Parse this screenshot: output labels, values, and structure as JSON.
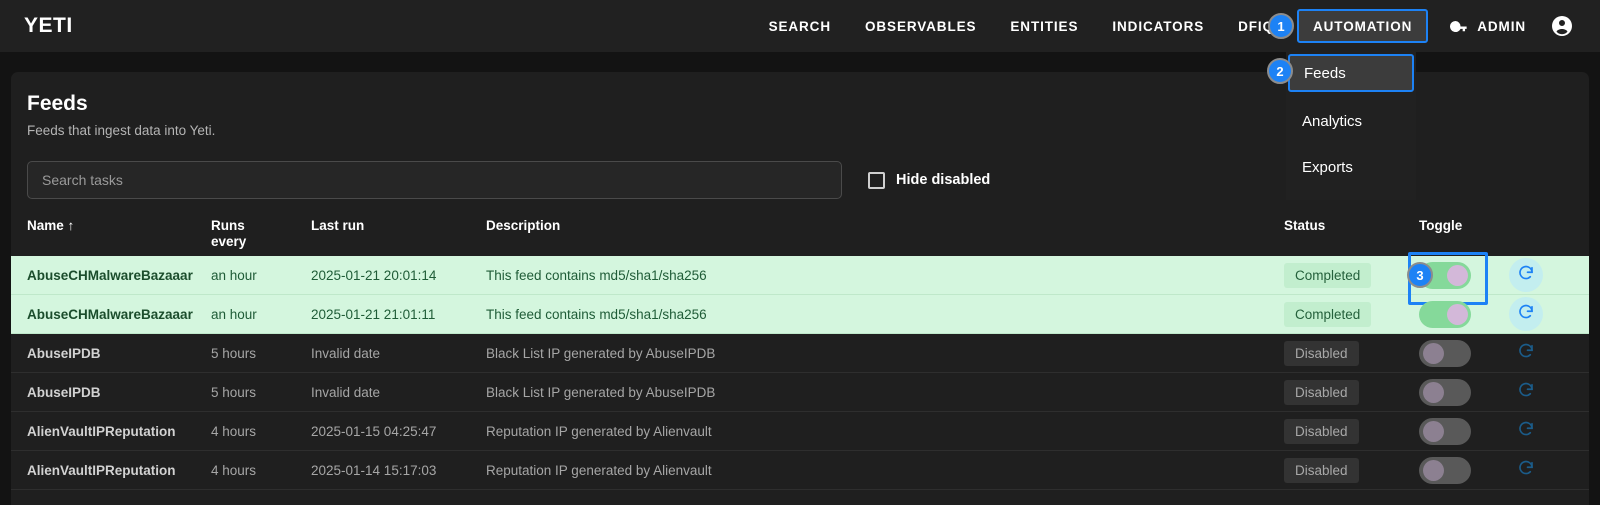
{
  "navbar": {
    "brand": "YETI",
    "items": [
      {
        "label": "SEARCH",
        "name": "nav-search"
      },
      {
        "label": "OBSERVABLES",
        "name": "nav-observables"
      },
      {
        "label": "ENTITIES",
        "name": "nav-entities"
      },
      {
        "label": "INDICATORS",
        "name": "nav-indicators"
      },
      {
        "label": "DFIQ",
        "name": "nav-dfiq"
      }
    ],
    "automation_label": "AUTOMATION",
    "admin_label": "ADMIN",
    "key_icon": "key-icon",
    "account_icon": "account-circle-icon"
  },
  "dropdown": {
    "items": [
      {
        "label": "Feeds",
        "selected": true
      },
      {
        "label": "Analytics",
        "selected": false
      },
      {
        "label": "Exports",
        "selected": false
      }
    ]
  },
  "badges": {
    "one": "1",
    "two": "2",
    "three": "3"
  },
  "page": {
    "title": "Feeds",
    "subtitle": "Feeds that ingest data into Yeti."
  },
  "search": {
    "placeholder": "Search tasks",
    "value": ""
  },
  "filter": {
    "hide_disabled_label": "Hide disabled",
    "hide_disabled_checked": false
  },
  "table": {
    "headers": {
      "name": "Name ↑",
      "runs_every": "Runs\never",
      "runs_every_line1": "Runs",
      "runs_every_line2": "every",
      "last_run": "Last run",
      "description": "Description",
      "status": "Status",
      "toggle": "Toggle"
    },
    "rows": [
      {
        "name": "AbuseCHMalwareBazaaar",
        "runs_every": "an hour",
        "last_run": "2025-01-21 20:01:14",
        "description": "This feed contains md5/sha1/sha256",
        "status": "Completed",
        "enabled": true,
        "focused": true
      },
      {
        "name": "AbuseCHMalwareBazaaar",
        "runs_every": "an hour",
        "last_run": "2025-01-21 21:01:11",
        "description": "This feed contains md5/sha1/sha256",
        "status": "Completed",
        "enabled": true,
        "focused": false
      },
      {
        "name": "AbuseIPDB",
        "runs_every": "5 hours",
        "last_run": "Invalid date",
        "description": "Black List IP generated by AbuseIPDB",
        "status": "Disabled",
        "enabled": false,
        "focused": false
      },
      {
        "name": "AbuseIPDB",
        "runs_every": "5 hours",
        "last_run": "Invalid date",
        "description": "Black List IP generated by AbuseIPDB",
        "status": "Disabled",
        "enabled": false,
        "focused": false
      },
      {
        "name": "AlienVaultIPReputation",
        "runs_every": "4 hours",
        "last_run": "2025-01-15 04:25:47",
        "description": "Reputation IP generated by Alienvault",
        "status": "Disabled",
        "enabled": false,
        "focused": false
      },
      {
        "name": "AlienVaultIPReputation",
        "runs_every": "4 hours",
        "last_run": "2025-01-14 15:17:03",
        "description": "Reputation IP generated by Alienvault",
        "status": "Disabled",
        "enabled": false,
        "focused": false
      }
    ],
    "refresh_icon": "refresh-icon"
  },
  "colors": {
    "accent_blue": "#1d82f5",
    "navbar_bg": "#212121",
    "card_bg": "#1f1f1f",
    "page_bg": "#131313",
    "row_enabled_bg": "#d4f6de",
    "toggle_on": "#85d99a",
    "toggle_off": "#595959"
  }
}
